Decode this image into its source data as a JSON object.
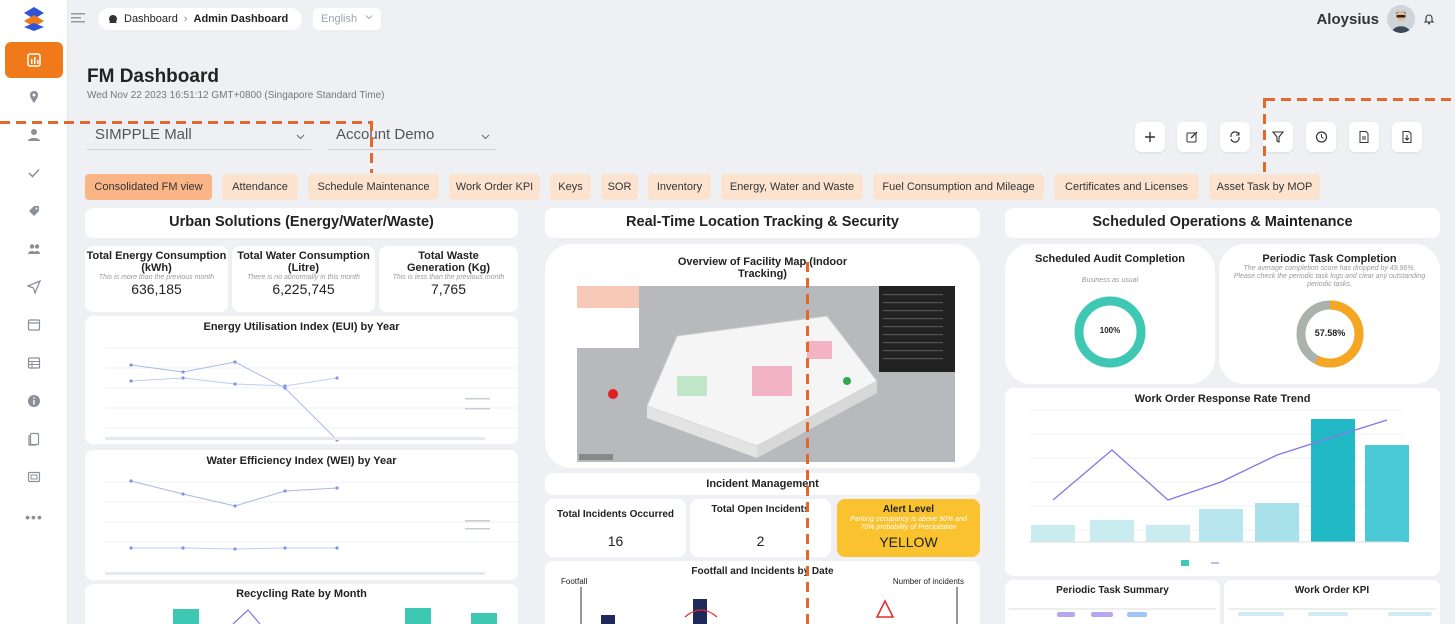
{
  "topbar": {
    "breadcrumb_root": "Dashboard",
    "breadcrumb_current": "Admin Dashboard",
    "language": "English",
    "user_name": "Aloysius"
  },
  "page": {
    "title": "FM Dashboard",
    "timestamp": "Wed Nov 22 2023 16:51:12 GMT+0800 (Singapore Standard Time)"
  },
  "filters": {
    "site": "SIMPPLE Mall",
    "account": "Account Demo"
  },
  "tabs": [
    "Consolidated FM view",
    "Attendance",
    "Schedule Maintenance",
    "Work Order KPI",
    "Keys",
    "SOR",
    "Inventory",
    "Energy, Water and Waste",
    "Fuel Consumption and Mileage",
    "Certificates and Licenses",
    "Asset Task by MOP"
  ],
  "urban": {
    "title": "Urban Solutions (Energy/Water/Waste)",
    "energy": {
      "title": "Total Energy Consumption (kWh)",
      "note": "This is more than the previous month",
      "value": "636,185"
    },
    "water": {
      "title": "Total Water Consumption (Litre)",
      "note": "There is no abnormally in this month",
      "value": "6,225,745"
    },
    "waste": {
      "title": "Total Waste Generation (Kg)",
      "note": "This is less than the previous month",
      "value": "7,765"
    },
    "eui_title": "Energy Utilisation Index (EUI) by Year",
    "wei_title": "Water Efficiency Index (WEI) by Year",
    "recycling_title": "Recycling Rate by Month"
  },
  "rtls": {
    "title": "Real-Time Location Tracking & Security",
    "map_title": "Overview of Facility Map (Indoor Tracking)",
    "incident_title": "Incident Management",
    "total_incidents_label": "Total Incidents Occurred",
    "total_incidents": "16",
    "open_incidents_label": "Total Open Incidents",
    "open_incidents": "2",
    "alert_label": "Alert Level",
    "alert_note": "Parking occupancy is above 90% and 70% probability of Precipitation",
    "alert_value": "YELLOW",
    "footfall_title": "Footfall and Incidents by Date",
    "footfall_ylabel": "Footfall",
    "incidents_ylabel": "Number of incidents"
  },
  "ops": {
    "title": "Scheduled Operations & Maintenance",
    "audit_title": "Scheduled Audit Completion",
    "audit_note": "Business as usual",
    "audit_value": "100%",
    "periodic_title": "Periodic Task Completion",
    "periodic_note": "The average completion score has dropped by 49.96%. Please check the periodic task logs and clear any outstanding periodic tasks.",
    "periodic_value": "57.58%",
    "wo_trend_title": "Work Order Response Rate Trend",
    "periodic_summary_title": "Periodic Task Summary",
    "wo_kpi_title": "Work Order KPI"
  },
  "colors": {
    "accent": "#f07a1a",
    "teal": "#3ec8b4",
    "amber": "#f5a623",
    "alert": "#f9c22e"
  }
}
